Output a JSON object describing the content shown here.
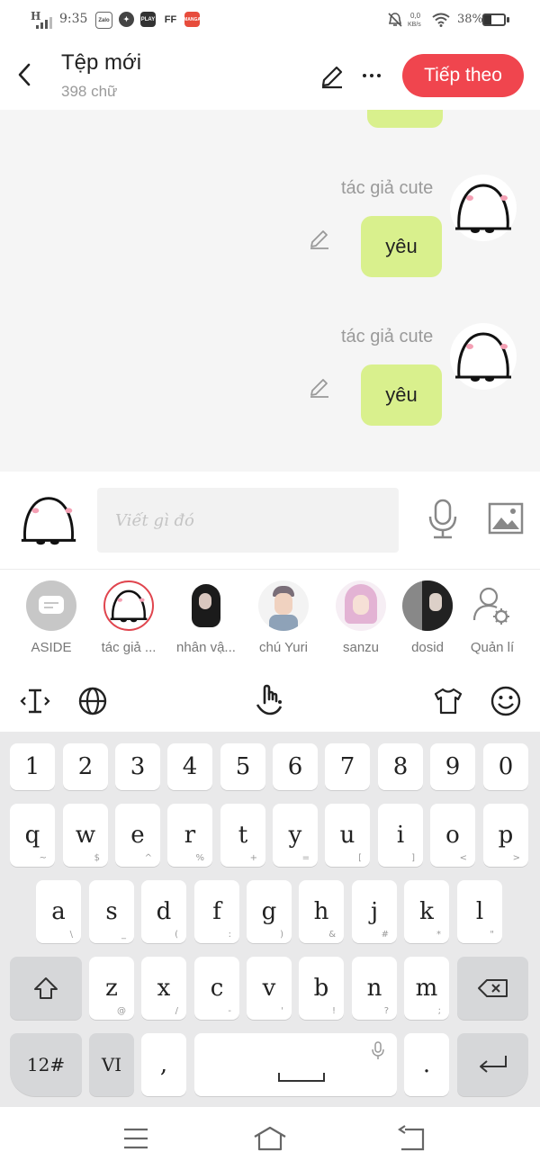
{
  "status_bar": {
    "signal": "H",
    "time": "9:35",
    "apps": [
      "Zalo",
      "PLAY",
      "FF",
      "MANGA"
    ],
    "network_speed_value": "0,0",
    "network_speed_unit": "KB/s",
    "battery": "38%"
  },
  "header": {
    "title": "Tệp mới",
    "subtitle": "398 chữ",
    "next_label": "Tiếp theo"
  },
  "chat": {
    "messages": [
      {
        "author": "tác giả cute",
        "text": "yêu"
      },
      {
        "author": "tác giả cute",
        "text": "yêu"
      }
    ]
  },
  "composer": {
    "placeholder": "Viết gì đó"
  },
  "characters": [
    {
      "label": "ASIDE"
    },
    {
      "label": "tác giả ..."
    },
    {
      "label": "nhân vậ..."
    },
    {
      "label": "chú Yuri"
    },
    {
      "label": "sanzu"
    },
    {
      "label": "dosid"
    },
    {
      "label": "Quản lí"
    }
  ],
  "keyboard": {
    "numbers": [
      "1",
      "2",
      "3",
      "4",
      "5",
      "6",
      "7",
      "8",
      "9",
      "0"
    ],
    "row1": [
      [
        "q",
        "~"
      ],
      [
        "w",
        "$"
      ],
      [
        "e",
        "^"
      ],
      [
        "r",
        "%"
      ],
      [
        "t",
        "+"
      ],
      [
        "y",
        "="
      ],
      [
        "u",
        "["
      ],
      [
        "i",
        "]"
      ],
      [
        "o",
        "<"
      ],
      [
        "p",
        ">"
      ]
    ],
    "row2": [
      [
        "a",
        "\\"
      ],
      [
        "s",
        "_"
      ],
      [
        "d",
        "("
      ],
      [
        "f",
        ":"
      ],
      [
        "g",
        ")"
      ],
      [
        "h",
        "&"
      ],
      [
        "j",
        "#"
      ],
      [
        "k",
        "*"
      ],
      [
        "l",
        "\""
      ]
    ],
    "row3": [
      [
        "z",
        "@"
      ],
      [
        "x",
        "/"
      ],
      [
        "c",
        "-"
      ],
      [
        "v",
        "'"
      ],
      [
        "b",
        "!"
      ],
      [
        "n",
        "?"
      ],
      [
        "m",
        ";"
      ]
    ],
    "symbols_label": "12#",
    "lang_label": "VI",
    "comma": ",",
    "period": "."
  }
}
